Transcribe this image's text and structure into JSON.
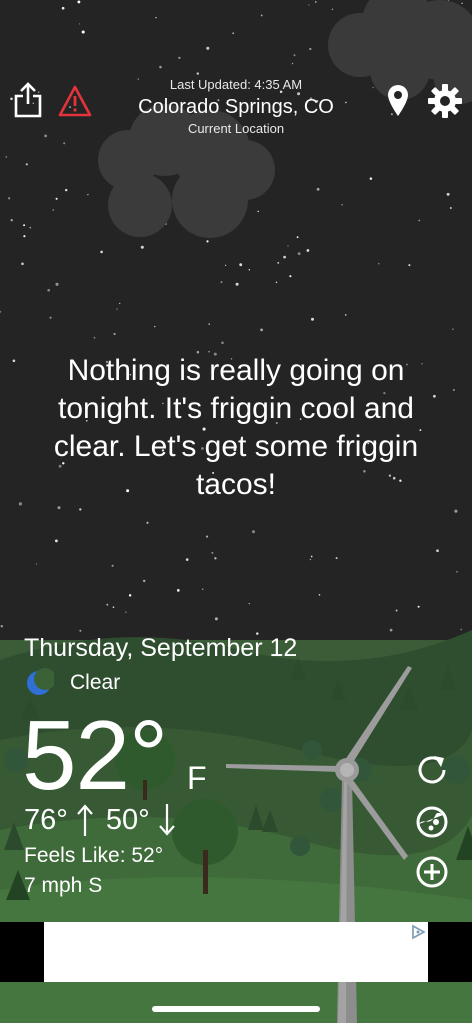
{
  "header": {
    "last_updated": "Last Updated: 4:35 AM",
    "city": "Colorado Springs, CO",
    "location_label": "Current Location"
  },
  "icons": {
    "share": "share-icon",
    "alert": "alert-triangle-icon",
    "location": "location-pin-icon",
    "settings": "gear-icon",
    "refresh": "refresh-icon",
    "radar": "radar-icon",
    "add": "plus-circle-icon"
  },
  "colors": {
    "alert": "#e5333b",
    "moon": "#2f6fd6",
    "sky": "#242424",
    "grass": "#3f6a3a"
  },
  "message": "Nothing is really going on tonight. It's friggin cool and clear. Let's get some friggin tacos!",
  "weather": {
    "date": "Thursday, September 12",
    "condition": "Clear",
    "temperature": "52°",
    "unit": "F",
    "high": "76°",
    "low": "50°",
    "feels_like": "Feels Like: 52°",
    "wind": "7 mph S"
  }
}
